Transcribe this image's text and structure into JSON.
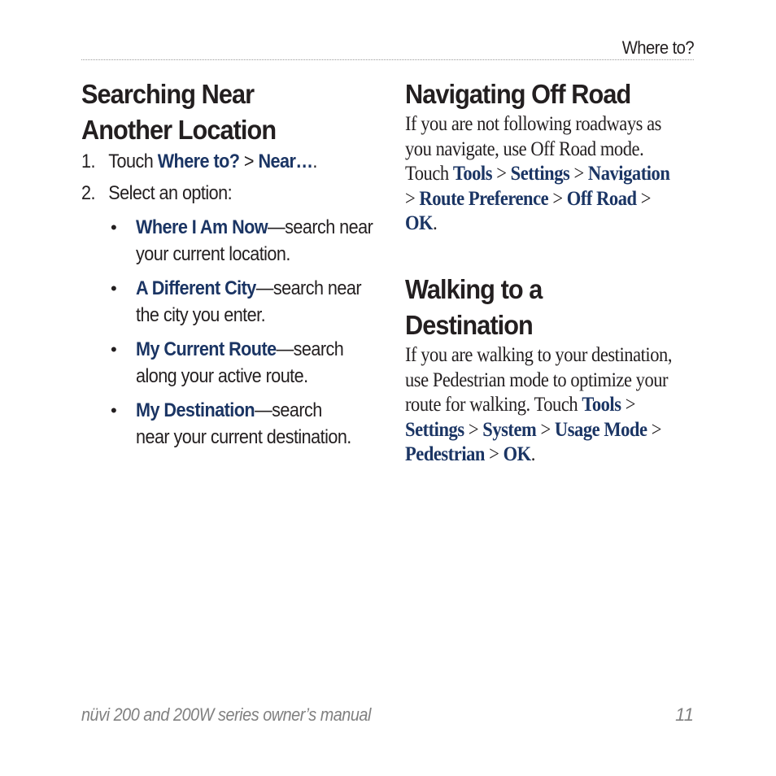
{
  "header": {
    "section_title": "Where to?"
  },
  "left_column": {
    "heading_line1": "Searching Near",
    "heading_line2": "Another Location",
    "steps": [
      {
        "number": "1.",
        "text": "Touch ",
        "path": [
          "Where to?",
          "Near…"
        ],
        "separator": " > ",
        "suffix": "."
      },
      {
        "number": "2.",
        "text": "Select an option:"
      }
    ],
    "options": [
      {
        "label": "Where I Am Now",
        "description": "—search near your current location."
      },
      {
        "label": "A Different City",
        "description": "—search near the city you enter."
      },
      {
        "label": "My Current Route",
        "description": "—search along your active route."
      },
      {
        "label": "My Destination",
        "description": "—search near your current destination."
      }
    ]
  },
  "right_column": {
    "offroad": {
      "heading": "Navigating Off Road",
      "body": "If you are not following roadways as you navigate, use Off Road mode. Touch ",
      "path": [
        "Tools",
        "Settings",
        "Navigation",
        "Route Preference",
        "Off Road",
        "OK"
      ],
      "separator": " > ",
      "suffix": "."
    },
    "walking": {
      "heading_line1": "Walking to a",
      "heading_line2": "Destination",
      "body": "If you are walking to your destination, use Pedestrian mode to optimize your route for walking. Touch ",
      "path": [
        "Tools",
        "Settings",
        "System",
        "Usage Mode",
        "Pedestrian",
        "OK"
      ],
      "separator": " > ",
      "suffix": "."
    }
  },
  "footer": {
    "manual_title": "nüvi 200 and 200W series owner’s manual",
    "page_number": "11"
  },
  "colors": {
    "link_blue": "#1b3564",
    "text": "#231f20",
    "footer_gray": "#808080"
  }
}
